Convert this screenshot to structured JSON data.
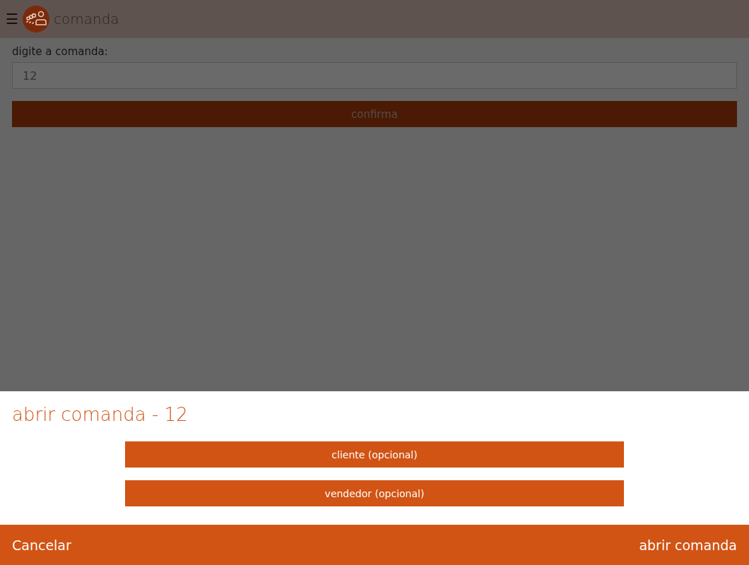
{
  "header": {
    "menu_glyph": "☰",
    "title": "comanda"
  },
  "form": {
    "label": "digite a comanda:",
    "value": "12",
    "button": "confirma"
  },
  "sheet": {
    "title": "abrir comanda - 12",
    "options": [
      "cliente (opcional)",
      "vendedor (opcional)"
    ]
  },
  "footer": {
    "cancel": "Cancelar",
    "confirm": "abrir comanda"
  }
}
